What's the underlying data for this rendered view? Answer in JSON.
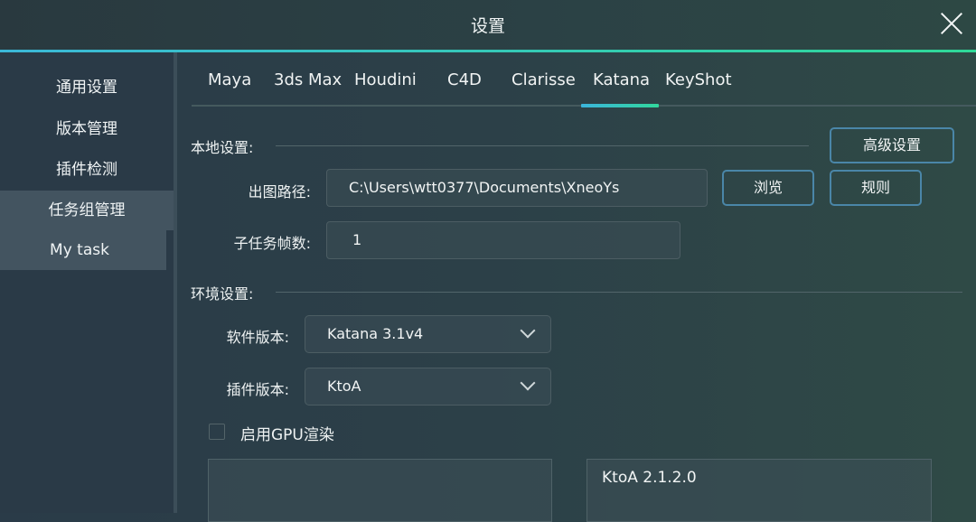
{
  "window": {
    "title": "设置",
    "close_icon": "close-icon"
  },
  "sidebar": {
    "items": [
      {
        "label": "通用设置",
        "active": false
      },
      {
        "label": "版本管理",
        "active": false
      },
      {
        "label": "插件检测",
        "active": false
      },
      {
        "label": "任务组管理",
        "active": true
      },
      {
        "label": "My task",
        "active": true
      }
    ]
  },
  "tabs": {
    "items": [
      {
        "label": "Maya"
      },
      {
        "label": "3ds Max"
      },
      {
        "label": "Houdini"
      },
      {
        "label": "C4D"
      },
      {
        "label": "Clarisse"
      },
      {
        "label": "Katana"
      },
      {
        "label": "KeyShot"
      }
    ],
    "active": "Katana",
    "accent_colors": [
      "#3bb5dc",
      "#31d89c"
    ]
  },
  "local_settings": {
    "section_label": "本地设置:",
    "advanced_button": "高级设置",
    "output_path": {
      "label": "出图路径:",
      "value": "C:\\Users\\wtt0377\\Documents\\XneoYs",
      "browse_button": "浏览",
      "rules_button": "规则"
    },
    "subtask_frames": {
      "label": "子任务帧数:",
      "value": "1"
    }
  },
  "env_settings": {
    "section_label": "环境设置:",
    "software_version": {
      "label": "软件版本:",
      "selected": "Katana 3.1v4"
    },
    "plugin_version": {
      "label": "插件版本:",
      "selected": "KtoA"
    },
    "gpu_render": {
      "label": "启用GPU渲染",
      "checked": false
    },
    "plugin_list_left": [],
    "plugin_list_right": [
      "KtoA 2.1.2.0"
    ]
  }
}
